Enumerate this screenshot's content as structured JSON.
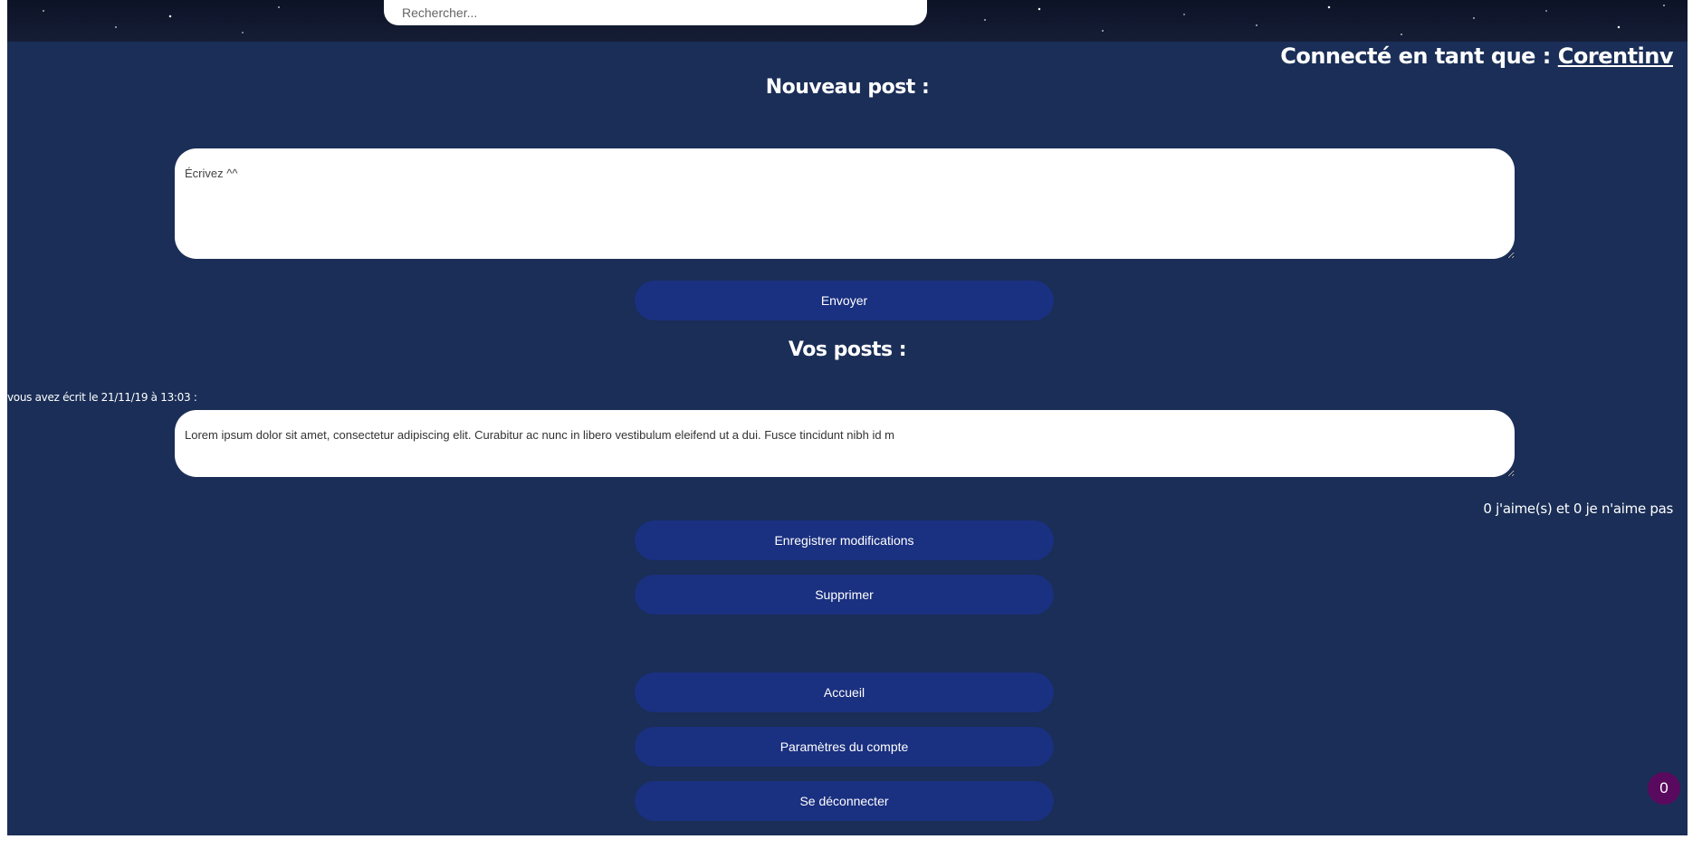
{
  "header": {
    "search_placeholder": "Rechercher...",
    "connected_label": "Connecté en tant que : ",
    "username": "Corentinv"
  },
  "new_post": {
    "title": "Nouveau post :",
    "textarea_placeholder": "Écrivez ^^",
    "send_label": "Envoyer"
  },
  "your_posts": {
    "title": "Vos posts :",
    "posts": [
      {
        "meta": "vous avez écrit le 21/11/19 à 13:03 :",
        "content": "Lorem ipsum dolor sit amet, consectetur adipiscing elit. Curabitur ac nunc in libero vestibulum eleifend ut a dui. Fusce tincidunt nibh id m",
        "likes_text": "0 j'aime(s) et 0 je n'aime pas",
        "save_label": "Enregistrer modifications",
        "delete_label": "Supprimer"
      }
    ]
  },
  "nav": {
    "home_label": "Accueil",
    "settings_label": "Paramètres du compte",
    "logout_label": "Se déconnecter"
  },
  "notification": {
    "count": "0",
    "color": "#5a0a5e"
  },
  "colors": {
    "background": "#1a2e57",
    "button": "#1a3080"
  }
}
